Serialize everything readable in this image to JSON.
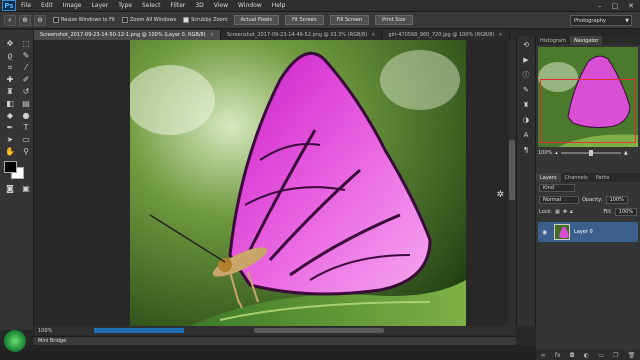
{
  "menu": {
    "logo": "Ps",
    "items": [
      "File",
      "Edit",
      "Image",
      "Layer",
      "Type",
      "Select",
      "Filter",
      "3D",
      "View",
      "Window",
      "Help"
    ],
    "window_controls": [
      "–",
      "□",
      "✕"
    ]
  },
  "options": {
    "resize_windows": "Resize Windows to Fit",
    "zoom_all": "Zoom All Windows",
    "scrubby_zoom": "Scrubby Zoom",
    "actual_pixels": "Actual Pixels",
    "fit_screen": "Fit Screen",
    "fill_screen": "Fill Screen",
    "print_size": "Print Size",
    "workspace": "Photography"
  },
  "tabs": [
    {
      "label": "Screenshot_2017-09-23-14-50-12-1.png @ 100% (Layer 0, RGB/8)",
      "active": true
    },
    {
      "label": "Screenshot_2017-09-23-14-49-52.png @ 33.3% (RGB/8)",
      "active": false
    },
    {
      "label": "girl-470568_960_720.jpg @ 100% (RGB/8)",
      "active": false
    }
  ],
  "status": {
    "zoom": "100%"
  },
  "minibridge": "Mini Bridge",
  "panels": {
    "tabs": [
      "Histogram",
      "Navigator"
    ],
    "zoom": "100%",
    "layers_tabs": [
      "Layers",
      "Channels",
      "Paths"
    ],
    "kind_label": "Kind",
    "blend_mode": "Normal",
    "opacity_label": "Opacity:",
    "opacity_value": "100%",
    "lock_label": "Lock:",
    "fill_label": "Fill:",
    "fill_value": "100%",
    "layer_name": "Layer 0"
  },
  "colors": {
    "foreground": "#000000",
    "background": "#ffffff",
    "accent": "#3b5f8a"
  }
}
